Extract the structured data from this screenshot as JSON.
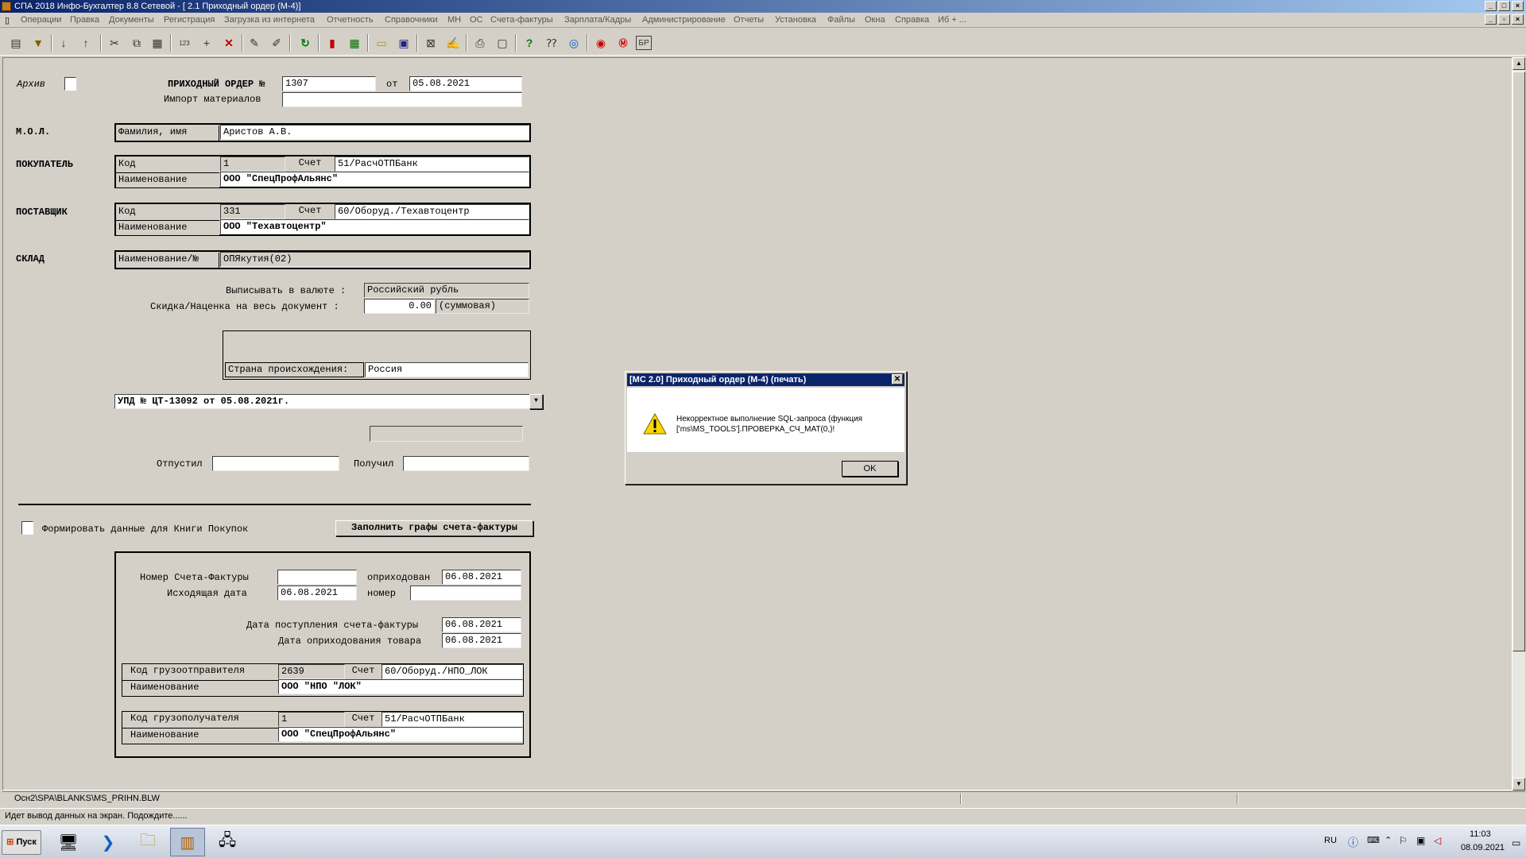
{
  "window": {
    "title": "СПА 2018 Инфо-Бухгалтер 8.8 Сетевой - [ 2.1 Приходный ордер (М-4)]"
  },
  "menu": [
    "Операции",
    "Правка",
    "Документы",
    "Регистрация",
    "Загрузка из интернета",
    "Отчетность",
    "Справочники",
    "МН",
    "ОС",
    "Счета-фактуры",
    "Зарплата/Кадры",
    "Администрирование",
    "Отчеты",
    "Установка",
    "Файлы",
    "Окна",
    "Справка",
    "Иб + ..."
  ],
  "toolbar_icons": [
    "select-icon",
    "filter-icon",
    "sort-asc-icon",
    "sort-desc-icon",
    "cut-icon",
    "copy-icon",
    "paste-icon",
    "calc-icon",
    "add-icon",
    "delete-icon",
    "mark-icon",
    "unmark-icon",
    "refresh-icon",
    "pdf-icon",
    "excel-icon",
    "open-icon",
    "save-icon",
    "export-icon",
    "edit-icon",
    "print-icon",
    "preview-icon",
    "help-icon",
    "whatis-icon",
    "browser-icon",
    "lifebuoy-icon",
    "m-icon",
    "br-icon"
  ],
  "form": {
    "archive_label": "Архив",
    "order_label": "ПРИХОДНЫЙ ОРДЕР №",
    "order_number": "1307",
    "from_label": "от",
    "order_date": "05.08.2021",
    "import_label": "Импорт материалов",
    "import_value": "",
    "mol_label": "М.О.Л.",
    "mol_field_label": "Фамилия, имя",
    "mol_value": "Аристов А.В.",
    "buyer_label": "ПОКУПАТЕЛЬ",
    "buyer": {
      "code_label": "Код",
      "code": "1",
      "account_label": "Счет",
      "account": "51/РасчОТПБанк",
      "name_label": "Наименование",
      "name": "ООО \"СпецПрофАльянс\""
    },
    "supplier_label": "ПОСТАВЩИК",
    "supplier": {
      "code_label": "Код",
      "code": "331",
      "account_label": "Счет",
      "account": "60/Оборуд./Техавтоцентр",
      "name_label": "Наименование",
      "name": "ООО \"Техавтоцентр\""
    },
    "warehouse_label": "СКЛАД",
    "warehouse_field_label": "Наименование/№",
    "warehouse": "ОПЯкутия(02)",
    "currency_label": "Выписывать в валюте :",
    "currency": "Российский рубль",
    "discount_label": "Скидка/Наценка на весь документ :",
    "discount": "0.00",
    "discount_type": "(суммовая)",
    "country_label": "Страна происхождения:",
    "country": "Россия",
    "upd_select": "УПД № ЦТ-13092 от 05.08.2021г.",
    "released_label": "Отпустил",
    "released": "",
    "received_label": "Получил",
    "received": "",
    "book_label": "Формировать данные для Книги Покупок",
    "fill_invoice_button": "Заполнить графы счета-фактуры",
    "invoice": {
      "number_label": "Номер Счета-Фактуры",
      "number": "",
      "posted_label": "оприходован",
      "posted": "06.08.2021",
      "outgoing_date_label": "Исходящая дата",
      "outgoing_date": "06.08.2021",
      "num_label": "номер",
      "num": "",
      "receipt_date_label": "Дата поступления счета-фактуры",
      "receipt_date": "06.08.2021",
      "goods_date_label": "Дата оприходования товара",
      "goods_date": "06.08.2021",
      "shipper_code_label": "Код грузоотправителя",
      "shipper_code": "2639",
      "shipper_account_label": "Счет",
      "shipper_account": "60/Оборуд./НПО_ЛОК",
      "shipper_name_label": "Наименование",
      "shipper_name": "ООО \"НПО \"ЛОК\"",
      "consignee_code_label": "Код грузополучателя",
      "consignee_code": "1",
      "consignee_account_label": "Счет",
      "consignee_account": "51/РасчОТПБанк",
      "consignee_name_label": "Наименование",
      "consignee_name": "ООО \"СпецПрофАльянс\""
    }
  },
  "dialog": {
    "title": "[MC 2.0] Приходный ордер (М-4) (печать)",
    "message": "Некорректное выполнение SQL-запроса (функция ['ms\\MS_TOOLS'].ПРОВЕРКА_СЧ_МАТ(0,)!",
    "ok_button": "OK"
  },
  "path": "Осн2\\SPA\\BLANKS\\MS_PRIHN.BLW",
  "status": "Идет вывод данных на экран. Подождите......",
  "taskbar": {
    "start": "Пуск",
    "lang": "RU",
    "time": "11:03",
    "date": "08.09.2021"
  }
}
